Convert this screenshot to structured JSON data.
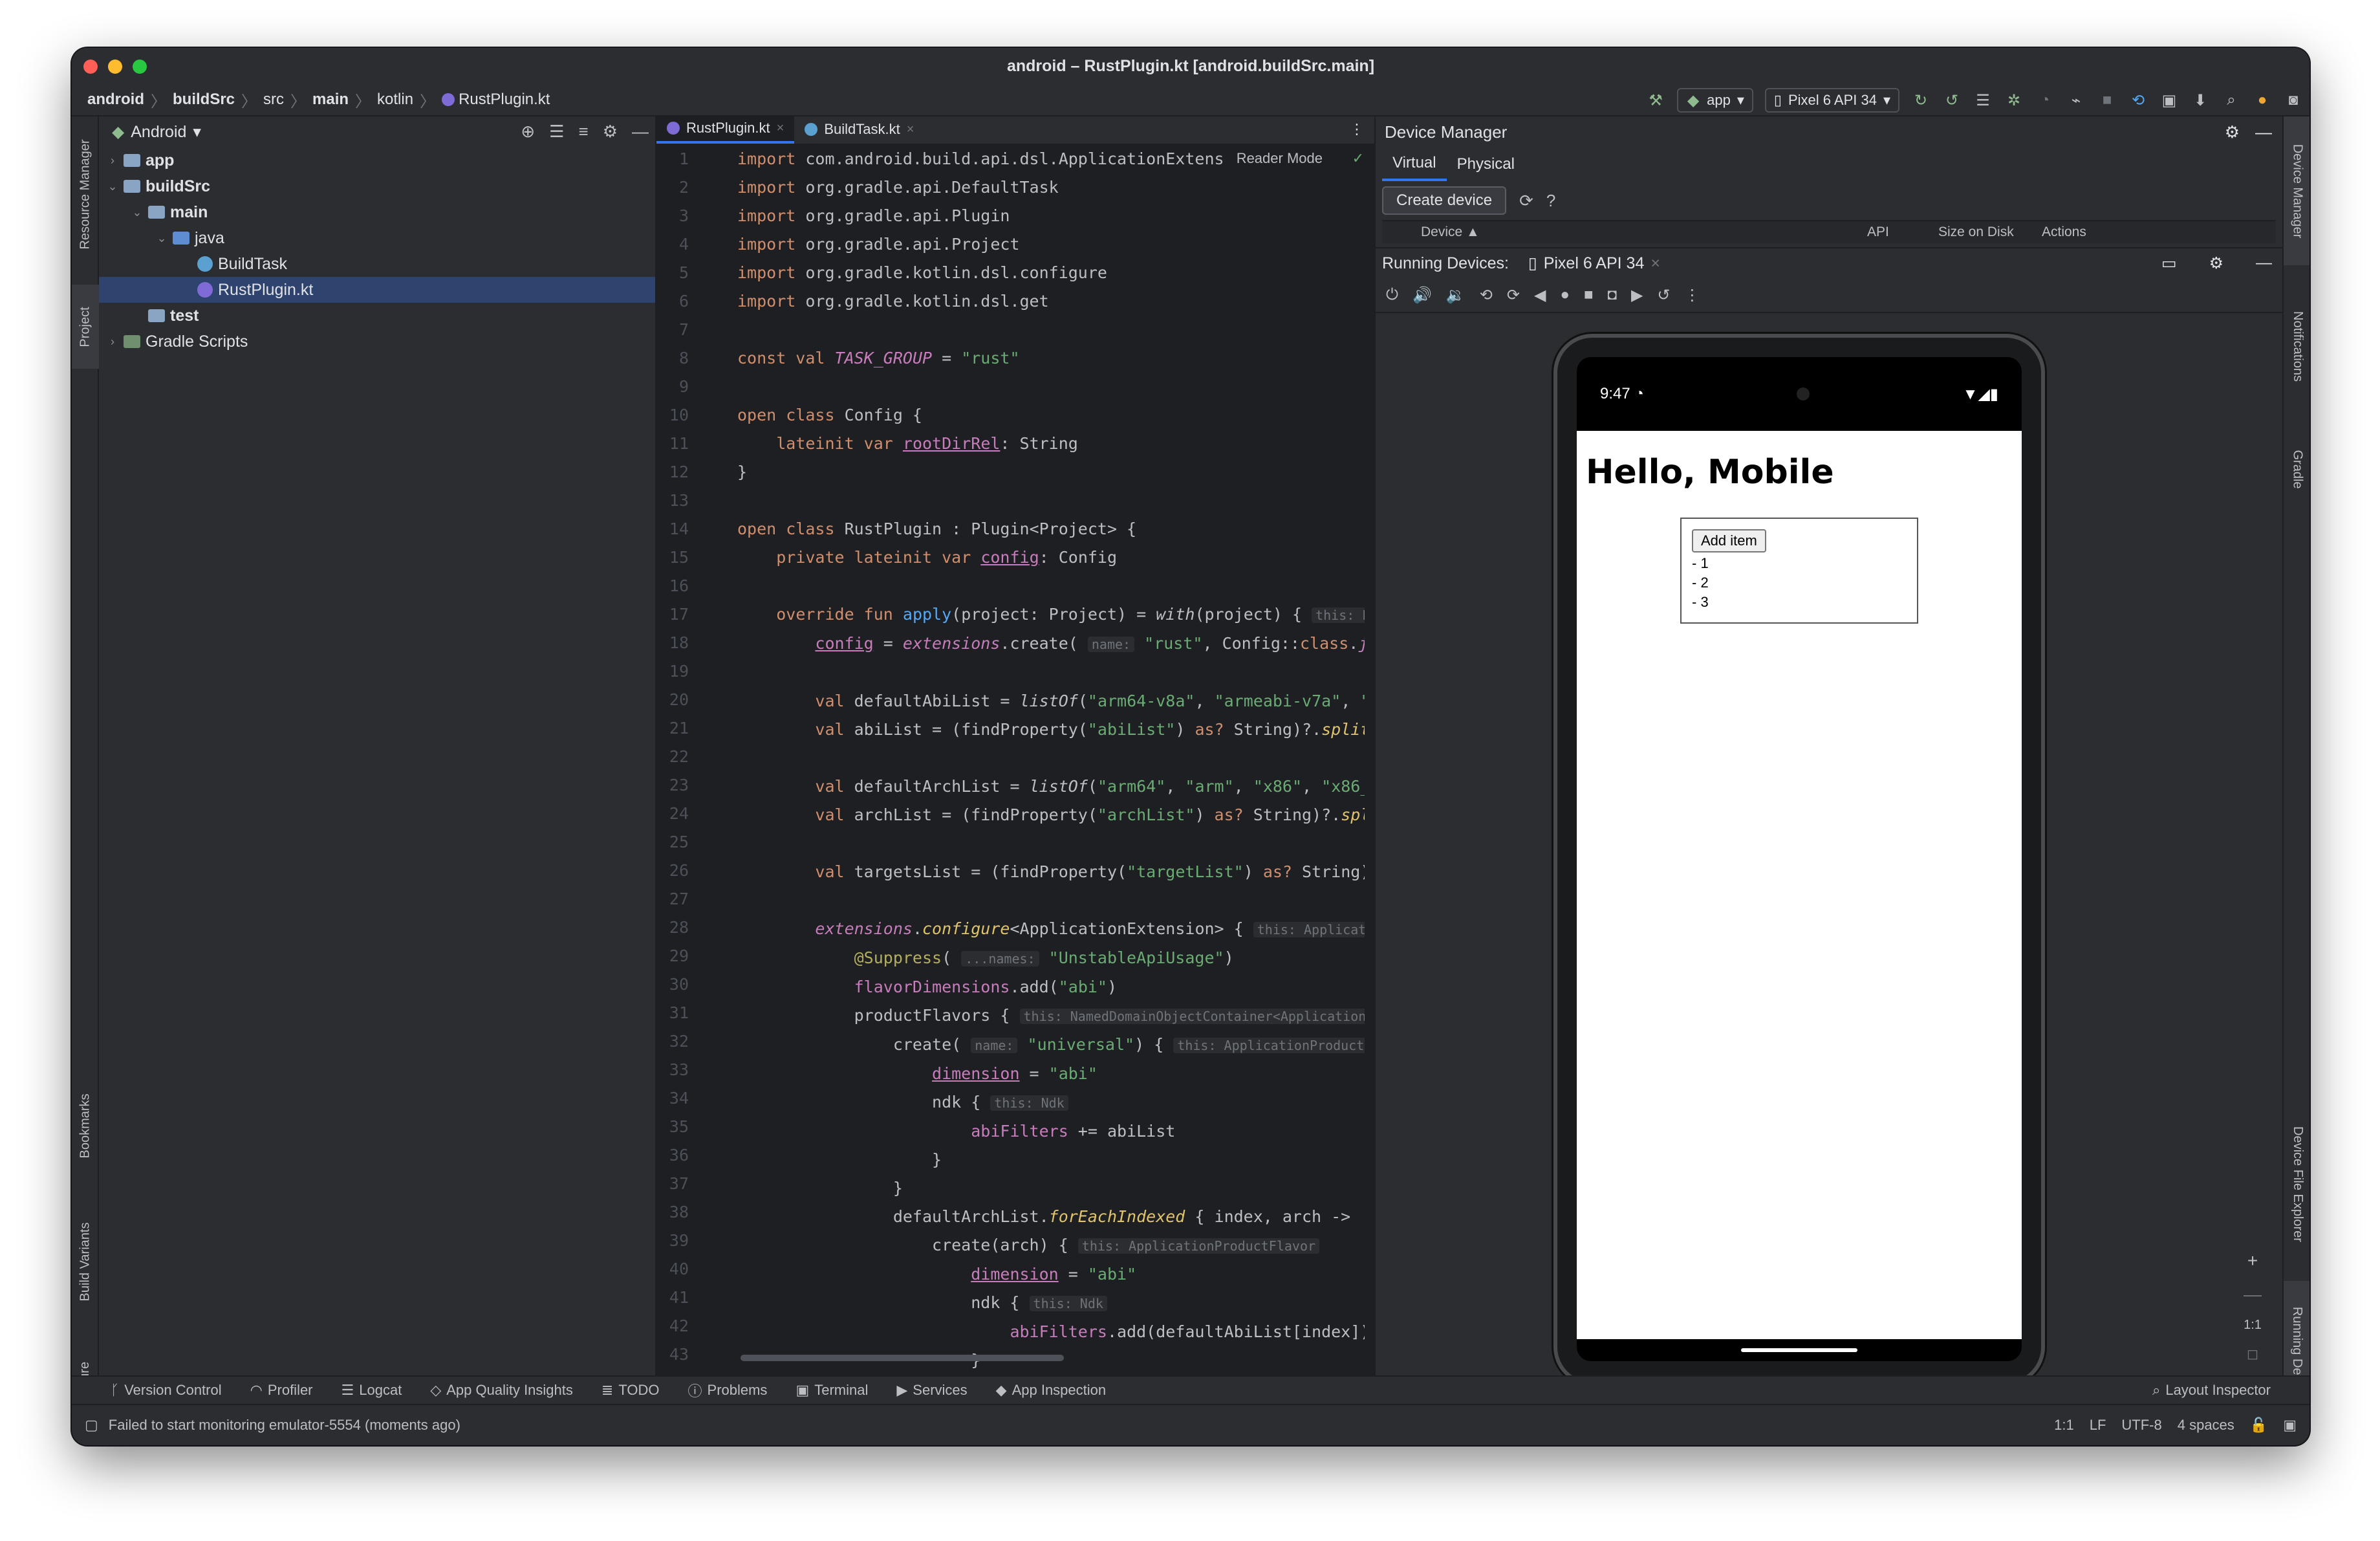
{
  "window": {
    "title": "android – RustPlugin.kt [android.buildSrc.main]"
  },
  "breadcrumb": [
    "android",
    "buildSrc",
    "src",
    "main",
    "kotlin",
    "RustPlugin.kt"
  ],
  "toolbar": {
    "run_config": "app",
    "device": "Pixel 6 API 34"
  },
  "left_strip": {
    "resource_manager": "Resource Manager",
    "project": "Project",
    "bookmarks": "Bookmarks",
    "build_variants": "Build Variants",
    "structure": "Structure"
  },
  "right_strip": {
    "device_manager": "Device Manager",
    "notifications": "Notifications",
    "gradle": "Gradle",
    "device_file_explorer": "Device File Explorer",
    "running_devices": "Running Devices"
  },
  "project": {
    "view": "Android",
    "tree": [
      {
        "label": "app"
      },
      {
        "label": "buildSrc"
      },
      {
        "label": "main"
      },
      {
        "label": "java"
      },
      {
        "label": "BuildTask"
      },
      {
        "label": "RustPlugin.kt"
      },
      {
        "label": "test"
      },
      {
        "label": "Gradle Scripts"
      }
    ]
  },
  "editor": {
    "tabs": [
      {
        "label": "RustPlugin.kt"
      },
      {
        "label": "BuildTask.kt"
      }
    ],
    "reader_mode": "Reader Mode",
    "line_numbers": [
      "1",
      "2",
      "3",
      "4",
      "5",
      "6",
      "7",
      "8",
      "9",
      "10",
      "11",
      "12",
      "13",
      "14",
      "15",
      "16",
      "17",
      "18",
      "19",
      "20",
      "21",
      "22",
      "23",
      "24",
      "25",
      "26",
      "27",
      "28",
      "29",
      "30",
      "31",
      "32",
      "33",
      "34",
      "35",
      "36",
      "37",
      "38",
      "39",
      "40",
      "41",
      "42",
      "43"
    ]
  },
  "device_manager": {
    "title": "Device Manager",
    "tabs": [
      "Virtual",
      "Physical"
    ],
    "create_button": "Create device",
    "columns": [
      "Device",
      "API",
      "Size on Disk",
      "Actions"
    ],
    "running_label": "Running Devices:",
    "running_tab": "Pixel 6 API 34"
  },
  "phone": {
    "time": "9:47",
    "heading": "Hello, Mobile",
    "add_button": "Add item",
    "items": [
      "- 1",
      "- 2",
      "- 3"
    ]
  },
  "zoom": {
    "plus": "+",
    "minus": "—",
    "one": "1:1"
  },
  "bottom_tools": [
    "Version Control",
    "Profiler",
    "Logcat",
    "App Quality Insights",
    "TODO",
    "Problems",
    "Terminal",
    "Services",
    "App Inspection"
  ],
  "layout_inspector": "Layout Inspector",
  "status": {
    "message": "Failed to start monitoring emulator-5554 (moments ago)",
    "position": "1:1",
    "line_sep": "LF",
    "encoding": "UTF-8",
    "indent": "4 spaces"
  },
  "colors": {
    "accent": "#3574f0",
    "background": "#2b2d30",
    "editor_bg": "#1e1f22"
  }
}
